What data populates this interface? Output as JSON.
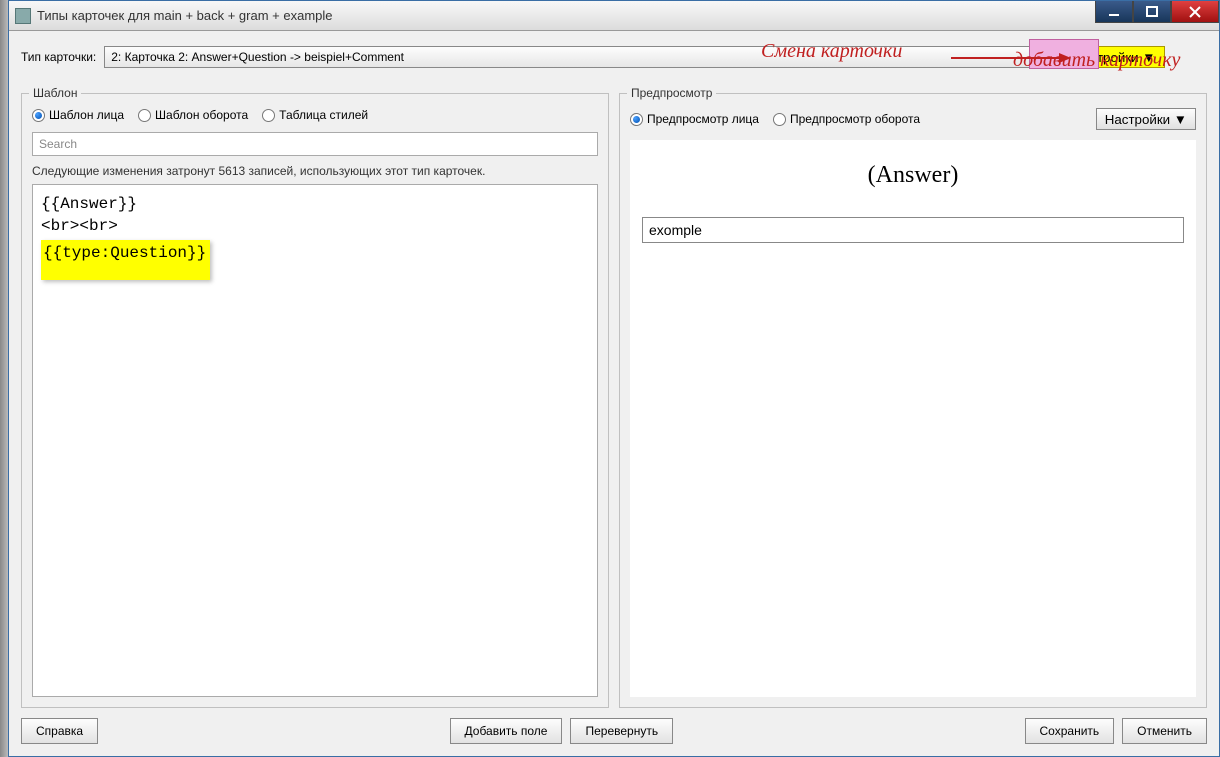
{
  "window": {
    "title": "Типы карточек для main + back + gram + example"
  },
  "top": {
    "label": "Тип карточки:",
    "combo_value": "2: Карточка 2: Answer+Question -> beispiel+Comment",
    "settings_btn": "Настройки ▼"
  },
  "annotations": {
    "change_card": "Смена карточки",
    "add_card": "добавить карточку"
  },
  "left": {
    "legend": "Шаблон",
    "radios": {
      "front": "Шаблон лица",
      "back": "Шаблон оборота",
      "styles": "Таблица стилей"
    },
    "search_placeholder": "Search",
    "info": "Следующие изменения затронут 5613 записей, использующих этот тип карточек.",
    "template": {
      "line1": "{{Answer}}",
      "line2": "<br><br>",
      "line3": "{{type:Question}}"
    }
  },
  "right": {
    "legend": "Предпросмотр",
    "radios": {
      "front": "Предпросмотр лица",
      "back": "Предпросмотр оборота"
    },
    "settings_btn": "Настройки ▼",
    "preview_heading": "(Answer)",
    "preview_value": "exomple"
  },
  "footer": {
    "help": "Справка",
    "add_field": "Добавить поле",
    "flip": "Перевернуть",
    "save": "Сохранить",
    "cancel": "Отменить"
  }
}
